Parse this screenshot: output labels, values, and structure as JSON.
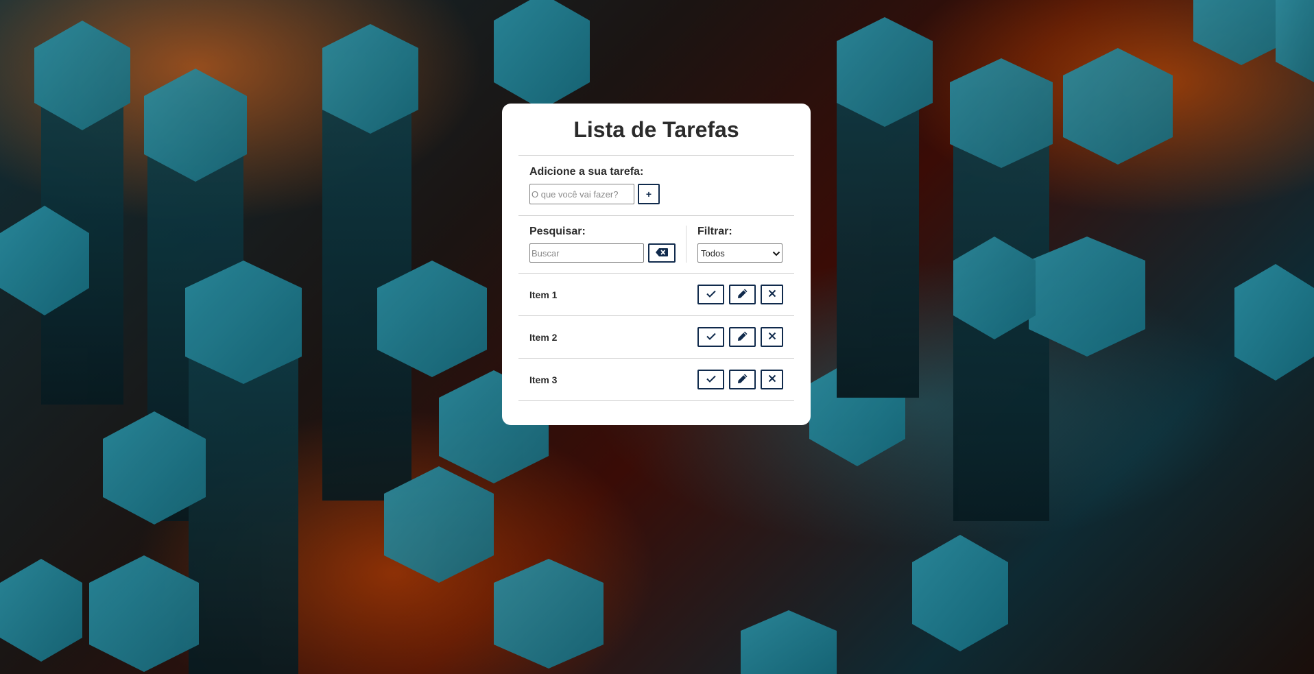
{
  "app": {
    "title": "Lista de Tarefas"
  },
  "add_section": {
    "label": "Adicione a sua tarefa:",
    "input_placeholder": "O que você vai fazer?",
    "input_value": "",
    "add_button_label": "+"
  },
  "search": {
    "label": "Pesquisar:",
    "placeholder": "Buscar",
    "value": "",
    "clear_icon": "backspace-icon"
  },
  "filter": {
    "label": "Filtrar:",
    "selected": "Todos"
  },
  "todos": [
    {
      "label": "Item 1"
    },
    {
      "label": "Item 2"
    },
    {
      "label": "Item 3"
    }
  ],
  "icons": {
    "done": "check-icon",
    "edit": "pencil-icon",
    "remove": "close-icon"
  },
  "colors": {
    "accent": "#102a4c",
    "card_bg": "#ffffff",
    "text": "#2b2b2b",
    "background_teal": "#1e96aa",
    "background_orange": "#ff6e14"
  }
}
